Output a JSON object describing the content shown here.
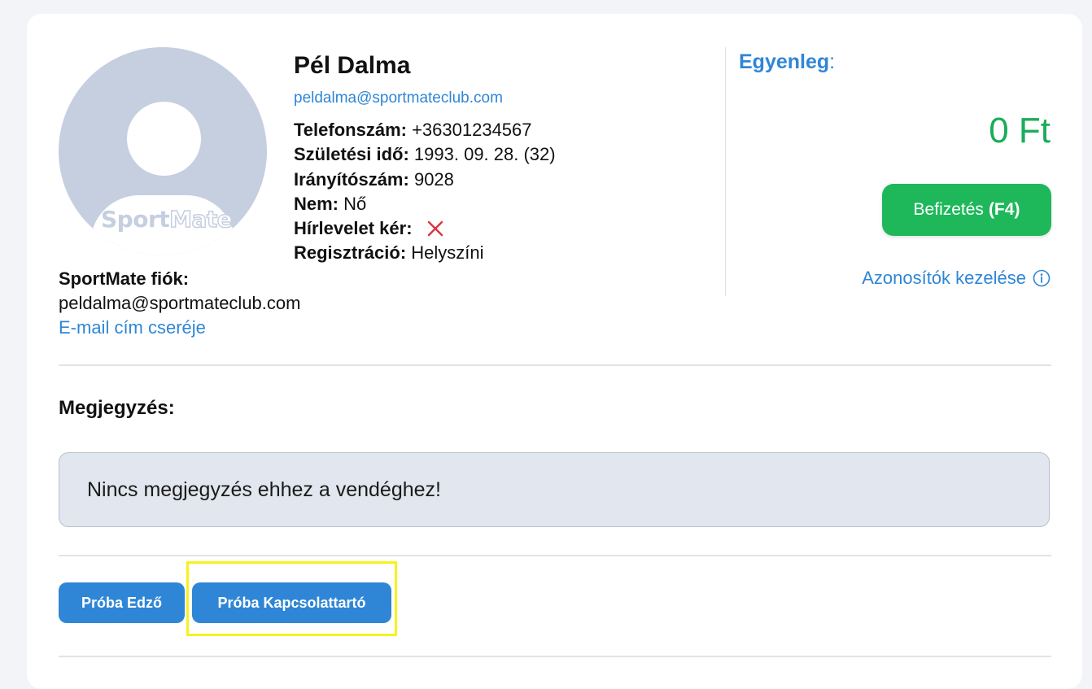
{
  "profile": {
    "name": "Pél Dalma",
    "email": "peldalma@sportmateclub.com",
    "avatar_logo_sport": "Sport",
    "avatar_logo_mate": "Mate",
    "details": [
      {
        "label": "Telefonszám:",
        "value": "+36301234567"
      },
      {
        "label": "Születési idő:",
        "value": "1993. 09. 28. (32)"
      },
      {
        "label": "Irányítószám:",
        "value": "9028"
      },
      {
        "label": "Nem:",
        "value": "Nő"
      },
      {
        "label": "Hírlevelet kér:",
        "value": ""
      },
      {
        "label": "Regisztráció:",
        "value": "Helyszíni"
      }
    ],
    "newsletter_icon": "x-icon",
    "newsletter_icon_color": "#d9343e"
  },
  "account": {
    "title": "SportMate fiók:",
    "email": "peldalma@sportmateclub.com",
    "change_email_link": "E-mail cím cseréje"
  },
  "balance": {
    "label": "Egyenleg",
    "colon": ":",
    "value": "0 Ft",
    "value_color": "#1aad58",
    "pay_label": "Befizetés",
    "pay_shortcut": "(F4)",
    "ids_link": "Azonosítók kezelése",
    "ids_icon": "info-icon"
  },
  "notes": {
    "title": "Megjegyzés:",
    "text": "Nincs megjegyzés ehhez a vendéghez!"
  },
  "roles": {
    "buttons": [
      "Próba Edző",
      "Próba Kapcsolattartó"
    ]
  },
  "colors": {
    "accent": "#2f86d6",
    "success": "#1eb85b",
    "highlight": "#f7f21c"
  }
}
